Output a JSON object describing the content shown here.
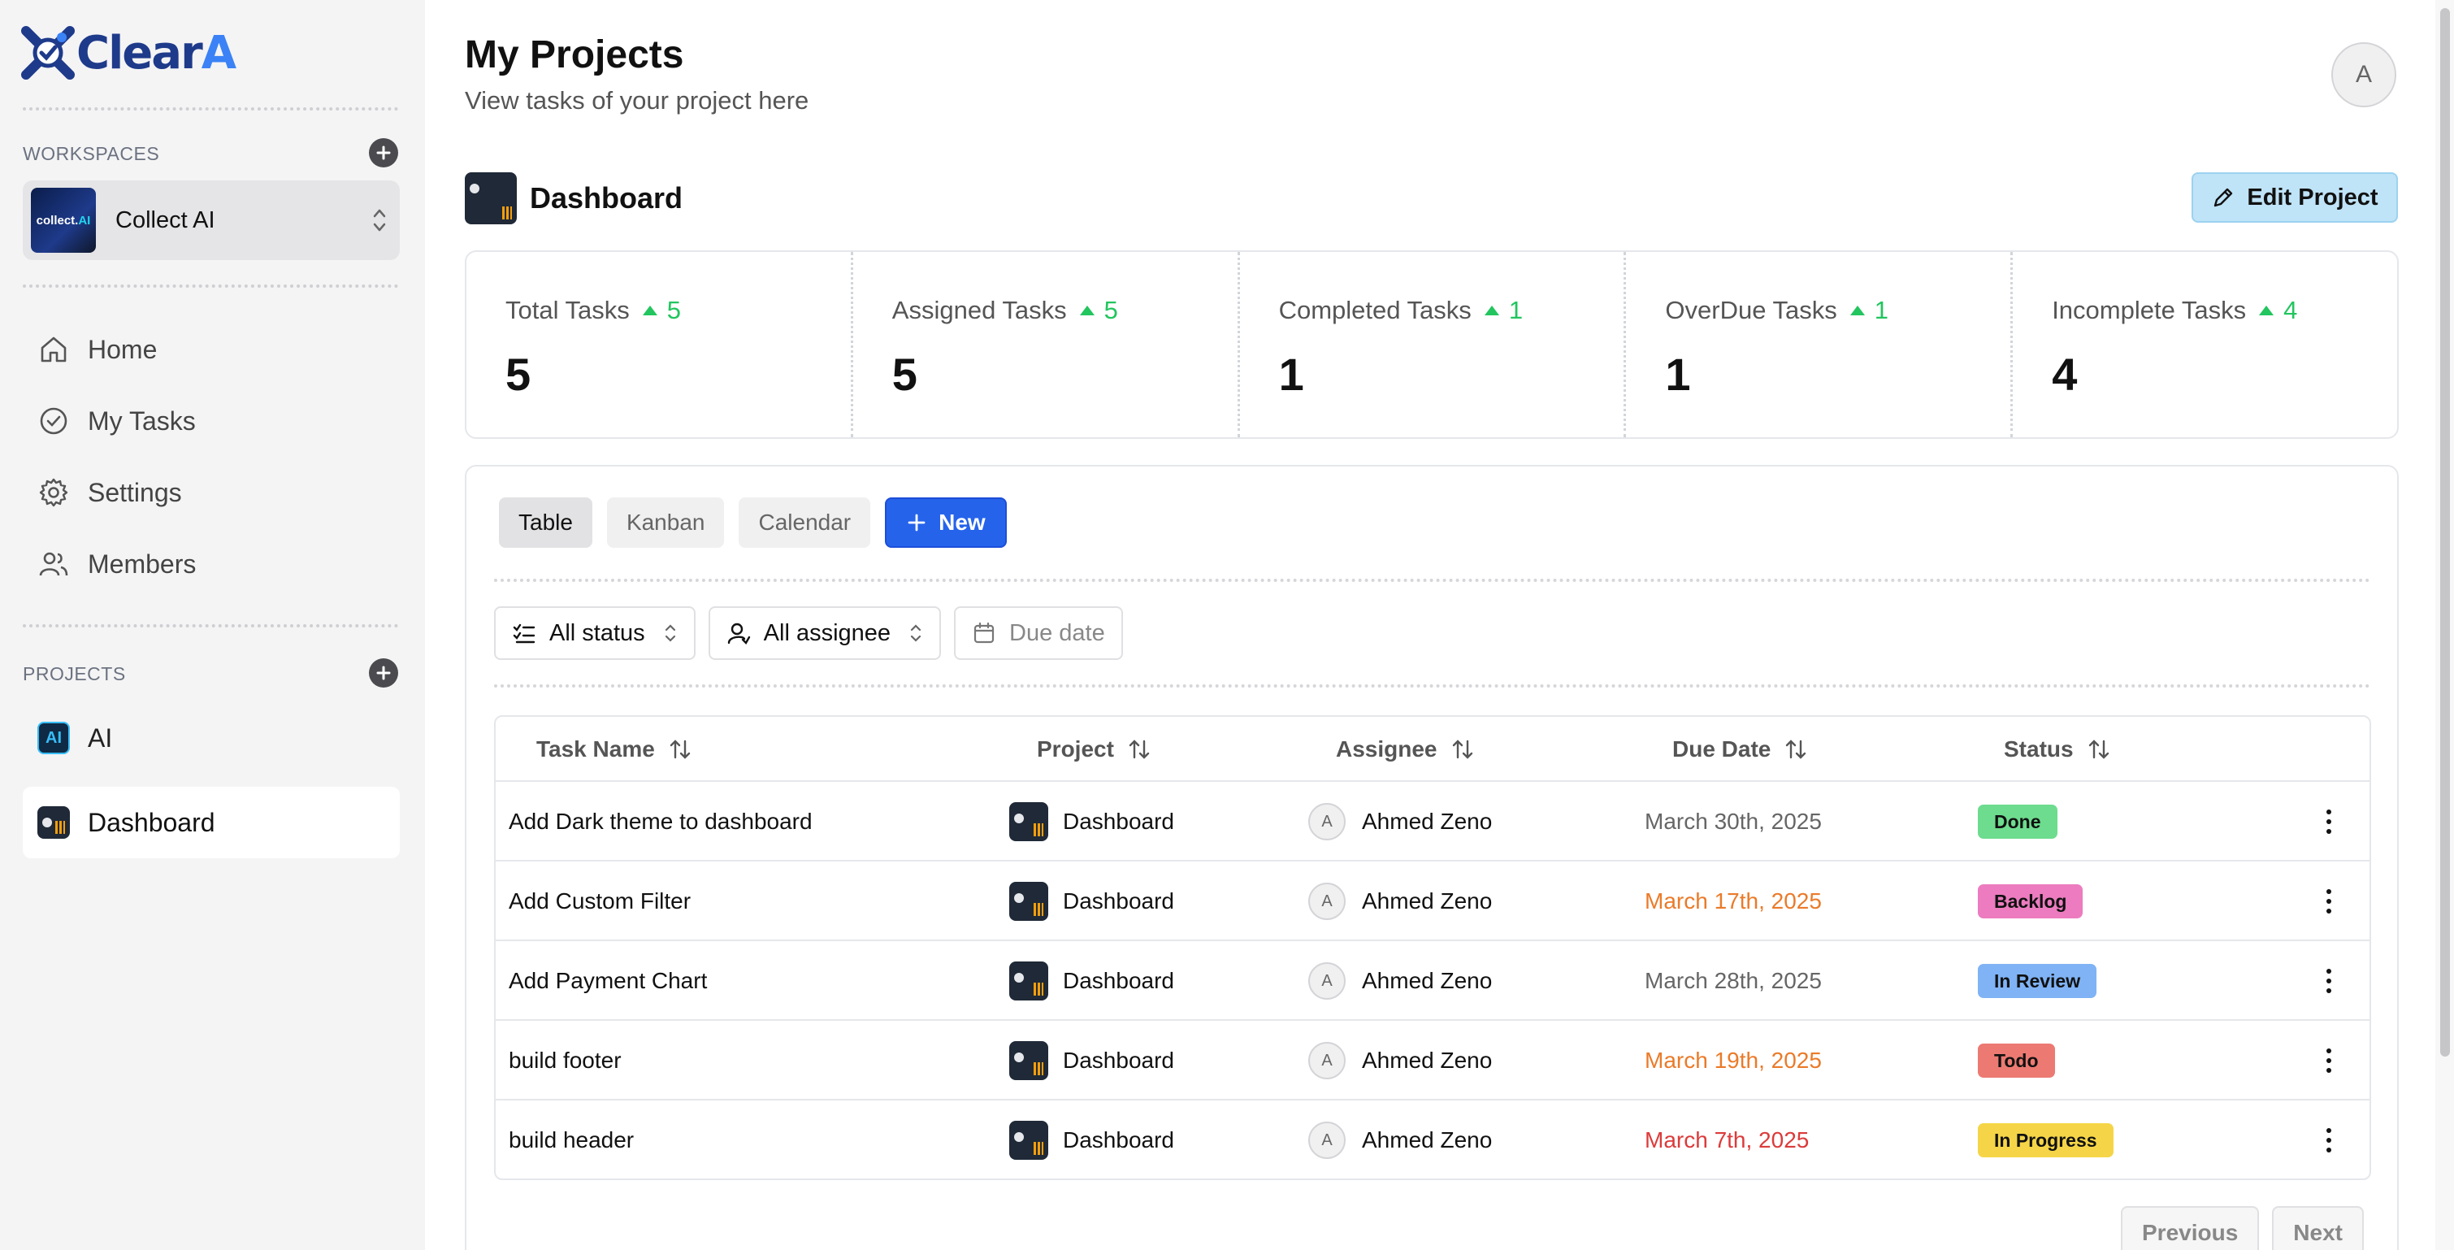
{
  "app": {
    "logo_text": "Clear",
    "logo_accent": "A",
    "brand_color": "#1e3a8a",
    "accent_color": "#3b82f6"
  },
  "sidebar": {
    "workspaces_label": "WORKSPACES",
    "workspace": {
      "name": "Collect AI",
      "thumb_text": "collect.",
      "thumb_accent": "AI"
    },
    "nav": [
      {
        "label": "Home",
        "icon": "home-icon"
      },
      {
        "label": "My Tasks",
        "icon": "check-circle-icon"
      },
      {
        "label": "Settings",
        "icon": "gear-icon"
      },
      {
        "label": "Members",
        "icon": "users-icon"
      }
    ],
    "projects_label": "PROJECTS",
    "projects": [
      {
        "label": "AI",
        "icon_text": "AI",
        "active": false
      },
      {
        "label": "Dashboard",
        "active": true
      }
    ]
  },
  "header": {
    "title": "My Projects",
    "subtitle": "View tasks of your project here",
    "avatar_initial": "A"
  },
  "project": {
    "name": "Dashboard",
    "edit_label": "Edit Project"
  },
  "stats": [
    {
      "label": "Total Tasks",
      "delta": "5",
      "value": "5"
    },
    {
      "label": "Assigned Tasks",
      "delta": "5",
      "value": "5"
    },
    {
      "label": "Completed Tasks",
      "delta": "1",
      "value": "1"
    },
    {
      "label": "OverDue Tasks",
      "delta": "1",
      "value": "1"
    },
    {
      "label": "Incomplete Tasks",
      "delta": "4",
      "value": "4"
    }
  ],
  "views": {
    "tabs": [
      "Table",
      "Kanban",
      "Calendar"
    ],
    "active": "Table",
    "new_label": "New"
  },
  "filters": {
    "status": "All status",
    "assignee": "All assignee",
    "due": "Due date"
  },
  "table": {
    "columns": [
      "Task Name",
      "Project",
      "Assignee",
      "Due Date",
      "Status"
    ],
    "rows": [
      {
        "task": "Add Dark theme to dashboard",
        "project": "Dashboard",
        "assignee_initial": "A",
        "assignee": "Ahmed Zeno",
        "due": "March 30th, 2025",
        "due_color": "#666666",
        "status": "Done",
        "status_color": "#6ddc8e"
      },
      {
        "task": "Add Custom Filter",
        "project": "Dashboard",
        "assignee_initial": "A",
        "assignee": "Ahmed Zeno",
        "due": "March 17th, 2025",
        "due_color": "#ea7b2a",
        "status": "Backlog",
        "status_color": "#ec7cbf"
      },
      {
        "task": "Add Payment Chart",
        "project": "Dashboard",
        "assignee_initial": "A",
        "assignee": "Ahmed Zeno",
        "due": "March 28th, 2025",
        "due_color": "#666666",
        "status": "In Review",
        "status_color": "#7fb3f5"
      },
      {
        "task": "build footer",
        "project": "Dashboard",
        "assignee_initial": "A",
        "assignee": "Ahmed Zeno",
        "due": "March 19th, 2025",
        "due_color": "#ea7b2a",
        "status": "Todo",
        "status_color": "#ec7a72"
      },
      {
        "task": "build header",
        "project": "Dashboard",
        "assignee_initial": "A",
        "assignee": "Ahmed Zeno",
        "due": "March 7th, 2025",
        "due_color": "#dc3b3b",
        "status": "In Progress",
        "status_color": "#f5d547"
      }
    ]
  },
  "pagination": {
    "previous": "Previous",
    "next": "Next"
  }
}
